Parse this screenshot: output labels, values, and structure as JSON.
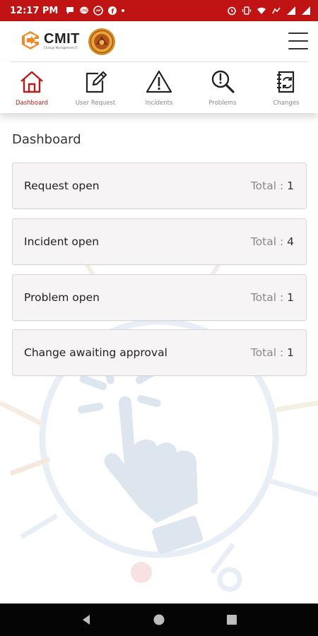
{
  "status_bar": {
    "time": "12:17 PM",
    "icons_left": [
      "chat-bubble-icon",
      "line-icon",
      "messenger-icon",
      "facebook-icon",
      "dot-icon"
    ],
    "icons_right": [
      "alarm-icon",
      "vibrate-icon",
      "wifi-icon",
      "data-saver-icon",
      "signal-icon",
      "signal-icon-2"
    ]
  },
  "header": {
    "logo_text": "CMIT",
    "logo_subtext": "Change Management IT",
    "menu_icon": "hamburger-menu-icon"
  },
  "nav_tabs": [
    {
      "label": "Dashboard",
      "icon": "home-icon",
      "active": true
    },
    {
      "label": "User Request",
      "icon": "edit-icon",
      "active": false
    },
    {
      "label": "Incidents",
      "icon": "warning-icon",
      "active": false
    },
    {
      "label": "Problems",
      "icon": "search-icon",
      "active": false
    },
    {
      "label": "Changes",
      "icon": "notebook-refresh-icon",
      "active": false
    }
  ],
  "dashboard": {
    "title": "Dashboard",
    "cards": [
      {
        "title": "Request open",
        "total_label": "Total : ",
        "total": "1"
      },
      {
        "title": "Incident open",
        "total_label": "Total : ",
        "total": "4"
      },
      {
        "title": "Problem open",
        "total_label": "Total : ",
        "total": "1"
      },
      {
        "title": "Change awaiting approval",
        "total_label": "Total : ",
        "total": "1"
      }
    ]
  },
  "system_nav": [
    "back-icon",
    "home-circle-icon",
    "recents-icon"
  ],
  "colors": {
    "status_bar": "#c01414",
    "accent": "#b71c1c",
    "card_bg": "#f6f4f5",
    "logo_orange": "#f08a24"
  }
}
